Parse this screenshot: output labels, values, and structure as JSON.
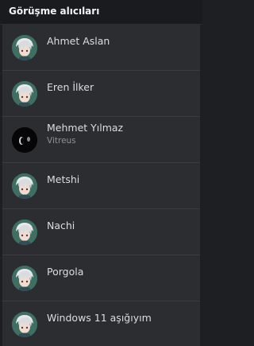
{
  "header": {
    "title": "Görüşme alıcıları"
  },
  "recipients": [
    {
      "name": "Ahmet Aslan",
      "avatar": "anime-avatar-icon"
    },
    {
      "name": "Eren İlker",
      "avatar": "anime-avatar-icon"
    },
    {
      "name": "Mehmet Yılmaz",
      "subtitle": "Vitreus",
      "avatar": "dark-avatar-icon"
    },
    {
      "name": "Metshi",
      "avatar": "anime-avatar-icon"
    },
    {
      "name": "Nachi",
      "avatar": "anime-avatar-icon"
    },
    {
      "name": "Porgola",
      "avatar": "anime-avatar-icon"
    },
    {
      "name": "Windows 11 aşığıyım",
      "avatar": "anime-avatar-icon"
    }
  ],
  "colors": {
    "background": "#1e1f22",
    "list_background": "#2b2d31",
    "text": "#dbdee1",
    "subtext": "#8e9297"
  }
}
